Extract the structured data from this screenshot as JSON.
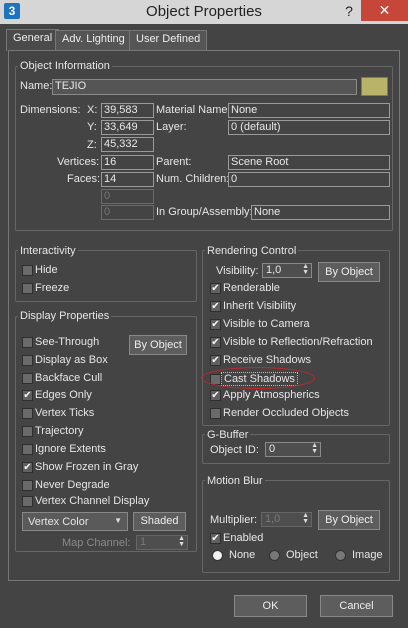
{
  "window": {
    "title": "Object Properties",
    "app_icon": "3",
    "help_glyph": "?",
    "close_glyph": "✕"
  },
  "tabs": [
    {
      "label": "General"
    },
    {
      "label": "Adv. Lighting"
    },
    {
      "label": "User Defined"
    }
  ],
  "object_info": {
    "title": "Object Information",
    "name_label": "Name:",
    "name_value": "TEJIO",
    "swatch_color": "#b9b36a",
    "dimensions_label": "Dimensions:",
    "x_label": "X:",
    "x_value": "39,583",
    "y_label": "Y:",
    "y_value": "33,649",
    "z_label": "Z:",
    "z_value": "45,332",
    "vertices_label": "Vertices:",
    "vertices_value": "16",
    "faces_label": "Faces:",
    "faces_value": "14",
    "extra1_value": "0",
    "extra2_value": "0",
    "material_label": "Material Name:",
    "material_value": "None",
    "layer_label": "Layer:",
    "layer_value": "0 (default)",
    "parent_label": "Parent:",
    "parent_value": "Scene Root",
    "children_label": "Num. Children:",
    "children_value": "0",
    "group_label": "In Group/Assembly:",
    "group_value": "None"
  },
  "interactivity": {
    "title": "Interactivity",
    "hide": "Hide",
    "freeze": "Freeze"
  },
  "display": {
    "title": "Display Properties",
    "by_object": "By Object",
    "items": [
      {
        "label": "See-Through",
        "checked": false
      },
      {
        "label": "Display as Box",
        "checked": false
      },
      {
        "label": "Backface Cull",
        "checked": false
      },
      {
        "label": "Edges Only",
        "checked": true
      },
      {
        "label": "Vertex Ticks",
        "checked": false
      },
      {
        "label": "Trajectory",
        "checked": false
      },
      {
        "label": "Ignore Extents",
        "checked": false
      },
      {
        "label": "Show Frozen in Gray",
        "checked": true
      },
      {
        "label": "Never Degrade",
        "checked": false
      },
      {
        "label": "Vertex Channel Display",
        "checked": false
      }
    ],
    "vertex_color": "Vertex Color",
    "shaded": "Shaded",
    "map_channel_label": "Map Channel:",
    "map_channel_value": "1"
  },
  "rendering": {
    "title": "Rendering Control",
    "visibility_label": "Visibility:",
    "visibility_value": "1,0",
    "by_object": "By Object",
    "items": [
      {
        "label": "Renderable",
        "checked": true
      },
      {
        "label": "Inherit Visibility",
        "checked": true
      },
      {
        "label": "Visible to Camera",
        "checked": true
      },
      {
        "label": "Visible to Reflection/Refraction",
        "checked": true
      },
      {
        "label": "Receive Shadows",
        "checked": true
      },
      {
        "label": "Cast Shadows",
        "checked": false
      },
      {
        "label": "Apply Atmospherics",
        "checked": true
      },
      {
        "label": "Render Occluded Objects",
        "checked": false
      }
    ]
  },
  "gbuffer": {
    "title": "G-Buffer",
    "object_id_label": "Object ID:",
    "object_id_value": "0"
  },
  "motion_blur": {
    "title": "Motion Blur",
    "multiplier_label": "Multiplier:",
    "multiplier_value": "1,0",
    "by_object": "By Object",
    "enabled": "Enabled",
    "radios": [
      {
        "label": "None",
        "checked": true
      },
      {
        "label": "Object",
        "checked": false
      },
      {
        "label": "Image",
        "checked": false
      }
    ]
  },
  "footer": {
    "ok": "OK",
    "cancel": "Cancel"
  },
  "check_glyph": "✔",
  "colors": {
    "close": "#c7463a",
    "annotation": "#c8262b"
  }
}
